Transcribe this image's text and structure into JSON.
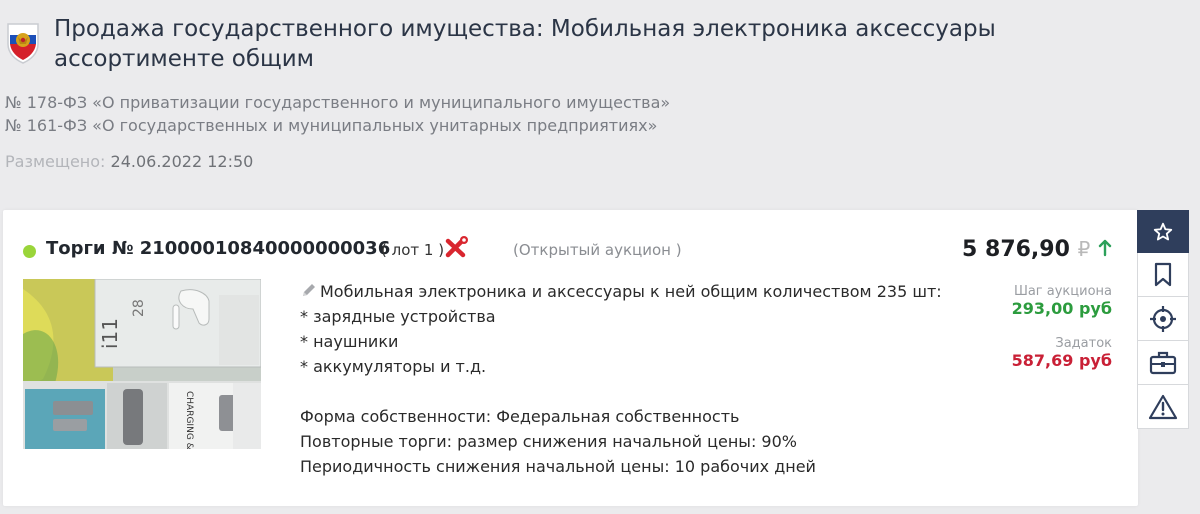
{
  "header": {
    "title": "Продажа государственного имущества: Мобильная электроника аксессуары ассортименте общим",
    "laws": [
      "№ 178-ФЗ «О приватизации государственного и муниципального имущества»",
      "№ 161-ФЗ «О государственных и муниципальных унитарных предприятиях»"
    ],
    "posted_label": "Размещено:",
    "posted_value": "24.06.2022 12:50"
  },
  "lot": {
    "title": "Торги № 21000010840000000036",
    "lot_number": "( лот 1 )",
    "auction_type": "(Открытый аукцион )",
    "price": "5 876,90",
    "currency": "₽",
    "trend_icon": "arrow-up-icon",
    "status_color": "#9ad53a",
    "description": [
      "Мобильная электроника и аксессуары к ней общим количеством 235 шт:",
      "* зарядные устройства",
      "* наушники",
      "* аккумуляторы и т.д."
    ],
    "details": [
      "Форма собственности: Федеральная собственность",
      "Повторные торги: размер снижения начальной цены: 90%",
      "Периодичность снижения начальной цены: 10 рабочих дней"
    ],
    "step_label": "Шаг аукциона",
    "step_value": "293,00 руб",
    "deposit_label": "Задаток",
    "deposit_value": "587,69 руб"
  },
  "sidebar": {
    "icons": [
      "star-icon",
      "bookmark-icon",
      "target-icon",
      "briefcase-icon",
      "warning-icon"
    ]
  }
}
